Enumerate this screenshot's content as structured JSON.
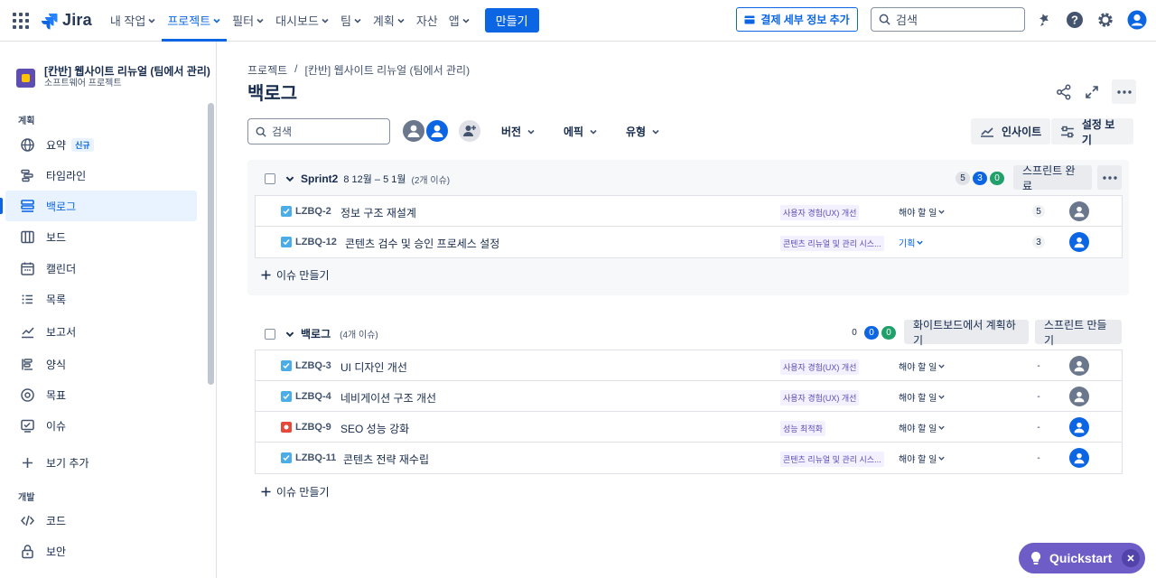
{
  "topnav": {
    "logo": "Jira",
    "items": [
      {
        "label": "내 작업",
        "chevron": true
      },
      {
        "label": "프로젝트",
        "chevron": true,
        "active": true
      },
      {
        "label": "필터",
        "chevron": true
      },
      {
        "label": "대시보드",
        "chevron": true
      },
      {
        "label": "팀",
        "chevron": true
      },
      {
        "label": "계획",
        "chevron": true
      },
      {
        "label": "자산",
        "chevron": false
      },
      {
        "label": "앱",
        "chevron": true
      }
    ],
    "create": "만들기",
    "billing": "결제 세부 정보 추가",
    "search_placeholder": "검색"
  },
  "sidebar": {
    "project_name": "[칸반] 웹사이트 리뉴얼 (팀에서 관리)",
    "project_type": "소프트웨어 프로젝트",
    "section_planning": "계획",
    "section_dev": "개발",
    "items": [
      {
        "label": "요약",
        "badge": "신규",
        "icon": "globe-icon"
      },
      {
        "label": "타임라인",
        "icon": "timeline-icon"
      },
      {
        "label": "백로그",
        "icon": "backlog-icon",
        "active": true
      },
      {
        "label": "보드",
        "icon": "board-icon"
      },
      {
        "label": "캘린더",
        "icon": "calendar-icon"
      },
      {
        "label": "목록",
        "icon": "list-icon"
      },
      {
        "label": "보고서",
        "icon": "reports-icon"
      },
      {
        "label": "양식",
        "icon": "forms-icon"
      },
      {
        "label": "목표",
        "icon": "goals-icon"
      },
      {
        "label": "이슈",
        "icon": "issues-icon"
      },
      {
        "label": "보기 추가",
        "icon": "plus-icon"
      },
      {
        "label": "코드",
        "icon": "code-icon"
      },
      {
        "label": "보안",
        "icon": "lock-icon"
      }
    ]
  },
  "main": {
    "breadcrumb": [
      "프로젝트",
      "/",
      "[칸반] 웹사이트 리뉴얼 (팀에서 관리)"
    ],
    "title": "백로그",
    "search_placeholder": "검색",
    "filters": [
      "버전",
      "에픽",
      "유형"
    ],
    "insights": "인사이트",
    "view_settings": "설정 보기"
  },
  "sprint": {
    "name": "Sprint2",
    "dates": "8 12월 – 5 1월",
    "issue_count": "(2개 이슈)",
    "counts": [
      "5",
      "3",
      "0"
    ],
    "complete_button": "스프린트 완료",
    "issues": [
      {
        "key": "LZBQ-2",
        "summary": "정보 구조 재설계",
        "epic": "사용자 경험(UX) 개선",
        "status": "해야 할 일",
        "sp": "5",
        "type": "task",
        "assignee": "gray"
      },
      {
        "key": "LZBQ-12",
        "summary": "콘텐츠 검수 및 승인 프로세스 설정",
        "epic": "콘텐츠 리뉴얼 및 관리 시스...",
        "status": "기획",
        "sp": "3",
        "type": "task",
        "assignee": "blue"
      }
    ],
    "create_issue": "이슈 만들기"
  },
  "backlog": {
    "name": "백로그",
    "issue_count": "(4개 이슈)",
    "counts": [
      "0",
      "0",
      "0"
    ],
    "whiteboard_button": "화이트보드에서 계획하기",
    "create_sprint_button": "스프린트 만들기",
    "issues": [
      {
        "key": "LZBQ-3",
        "summary": "UI 디자인 개선",
        "epic": "사용자 경험(UX) 개선",
        "status": "해야 할 일",
        "sp": "-",
        "type": "task",
        "assignee": "gray"
      },
      {
        "key": "LZBQ-4",
        "summary": "네비게이션 구조 개선",
        "epic": "사용자 경험(UX) 개선",
        "status": "해야 할 일",
        "sp": "-",
        "type": "task",
        "assignee": "gray"
      },
      {
        "key": "LZBQ-9",
        "summary": "SEO 성능 강화",
        "epic": "성능 최적화",
        "status": "해야 할 일",
        "sp": "-",
        "type": "bug",
        "assignee": "blue"
      },
      {
        "key": "LZBQ-11",
        "summary": "콘텐츠 전략 재수립",
        "epic": "콘텐츠 리뉴얼 및 관리 시스...",
        "status": "해야 할 일",
        "sp": "-",
        "type": "task",
        "assignee": "blue"
      }
    ],
    "create_issue": "이슈 만들기"
  },
  "quickstart": "Quickstart",
  "colors": {
    "brand": "#0c66e4",
    "quickstart": "#6e5dc6"
  }
}
